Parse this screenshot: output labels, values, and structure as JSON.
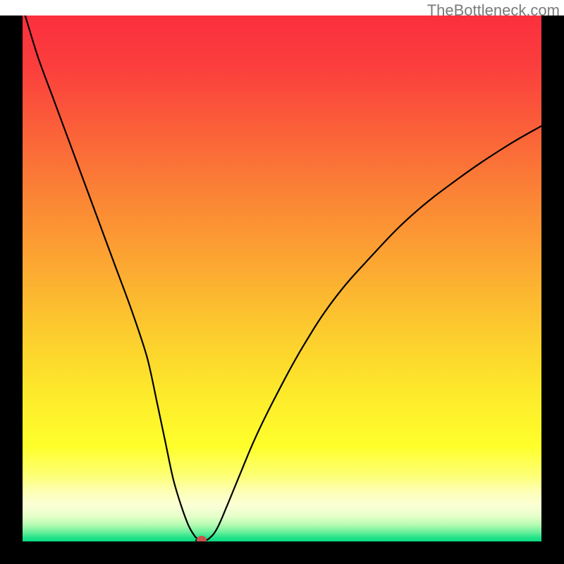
{
  "watermark": "TheBottleneck.com",
  "colors": {
    "curve_stroke": "#000000",
    "frame": "#000000",
    "marker": "#c9534b",
    "gradient_stops": [
      {
        "offset": 0.0,
        "color": "#fb2f3e"
      },
      {
        "offset": 0.1,
        "color": "#fb3f3d"
      },
      {
        "offset": 0.22,
        "color": "#fb6139"
      },
      {
        "offset": 0.35,
        "color": "#fb8635"
      },
      {
        "offset": 0.48,
        "color": "#fca932"
      },
      {
        "offset": 0.6,
        "color": "#fccb2e"
      },
      {
        "offset": 0.72,
        "color": "#fdea2b"
      },
      {
        "offset": 0.82,
        "color": "#feff2b"
      },
      {
        "offset": 0.875,
        "color": "#fdff75"
      },
      {
        "offset": 0.905,
        "color": "#fdffb5"
      },
      {
        "offset": 0.932,
        "color": "#fbffd6"
      },
      {
        "offset": 0.952,
        "color": "#e6ffc9"
      },
      {
        "offset": 0.968,
        "color": "#b6fbb3"
      },
      {
        "offset": 0.982,
        "color": "#6cf09c"
      },
      {
        "offset": 0.992,
        "color": "#28e38b"
      },
      {
        "offset": 1.0,
        "color": "#05db82"
      }
    ]
  },
  "chart_data": {
    "type": "line",
    "title": "",
    "xlabel": "",
    "ylabel": "",
    "x_range": [
      0,
      100
    ],
    "y_range": [
      0,
      100
    ],
    "series": [
      {
        "name": "bottleneck-curve",
        "x": [
          0.5,
          3,
          6,
          9,
          12,
          15,
          18,
          21,
          24,
          26,
          27.5,
          29,
          30.5,
          32,
          33.2,
          34,
          35,
          36,
          37.5,
          39.5,
          42,
          45,
          49,
          54,
          60,
          67,
          75,
          84,
          93,
          100
        ],
        "y": [
          100,
          92,
          84,
          76,
          68,
          60,
          52,
          44,
          35,
          26,
          19,
          12,
          7,
          3,
          1,
          0.3,
          0.2,
          0.6,
          2.5,
          7,
          13,
          20,
          28,
          37,
          46,
          54,
          62,
          69,
          75,
          79
        ]
      }
    ],
    "marker": {
      "x": 34.5,
      "y": 0.3
    },
    "flat_bottom": {
      "x_start": 33.4,
      "x_end": 35.2,
      "y": 0.2
    }
  }
}
